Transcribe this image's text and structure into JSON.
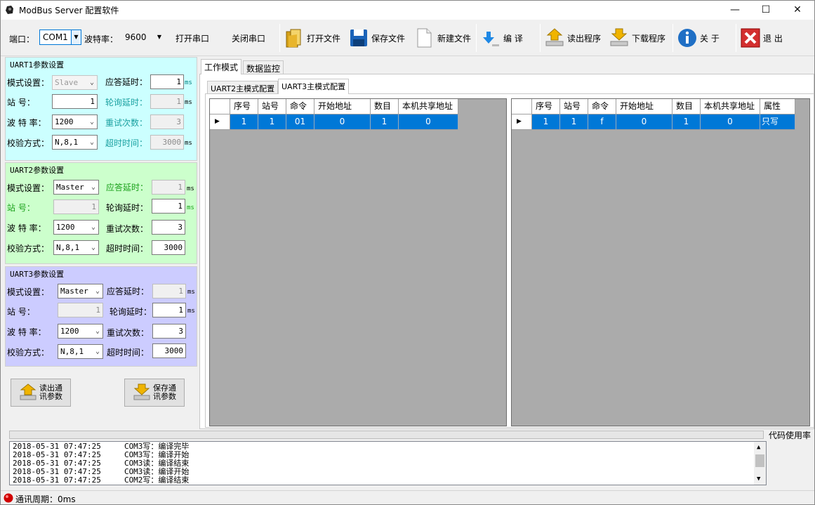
{
  "window": {
    "title": "ModBus Server 配置软件",
    "controls": {
      "minimize": "—",
      "maximize": "☐",
      "close": "✕"
    }
  },
  "toolbar": {
    "port_label": "端口：",
    "port_value": "COM1",
    "baud_label": "波特率：",
    "baud_value": "9600",
    "open_port": "打开串口",
    "close_port": "关闭串口",
    "open_file": "打开文件",
    "save_file": "保存文件",
    "new_file": "新建文件",
    "compile": "编  译",
    "read_program": "读出程序",
    "download_program": "下载程序",
    "about": "关  于",
    "exit": "退  出"
  },
  "uart1": {
    "title": "UART1参数设置",
    "mode_label": "模式设置：",
    "mode_value": "Slave",
    "reply_delay_label": "应答延时：",
    "reply_delay_value": "1",
    "station_label": "站  号：",
    "station_value": "1",
    "poll_delay_label": "轮询延时：",
    "poll_delay_value": "1",
    "baud_label": "波 特 率：",
    "baud_value": "1200",
    "retry_label": "重试次数：",
    "retry_value": "3",
    "parity_label": "校验方式：",
    "parity_value": "N,8,1",
    "timeout_label": "超时时间：",
    "timeout_value": "3000",
    "unit": "ms"
  },
  "uart2": {
    "title": "UART2参数设置",
    "mode_label": "模式设置：",
    "mode_value": "Master",
    "reply_delay_label": "应答延时：",
    "reply_delay_value": "1",
    "station_label": "站  号：",
    "station_value": "1",
    "poll_delay_label": "轮询延时：",
    "poll_delay_value": "1",
    "baud_label": "波 特 率：",
    "baud_value": "1200",
    "retry_label": "重试次数：",
    "retry_value": "3",
    "parity_label": "校验方式：",
    "parity_value": "N,8,1",
    "timeout_label": "超时时间：",
    "timeout_value": "3000",
    "unit": "ms"
  },
  "uart3": {
    "title": "UART3参数设置",
    "mode_label": "模式设置：",
    "mode_value": "Master",
    "reply_delay_label": "应答延时：",
    "reply_delay_value": "1",
    "station_label": "站  号：",
    "station_value": "1",
    "poll_delay_label": "轮询延时：",
    "poll_delay_value": "1",
    "baud_label": "波 特 率：",
    "baud_value": "1200",
    "retry_label": "重试次数：",
    "retry_value": "3",
    "parity_label": "校验方式：",
    "parity_value": "N,8,1",
    "timeout_label": "超时时间：",
    "timeout_value": "3000",
    "unit": "ms"
  },
  "buttons": {
    "read_comm_l1": "读出通",
    "read_comm_l2": "讯参数",
    "save_comm_l1": "保存通",
    "save_comm_l2": "讯参数"
  },
  "tabs": {
    "work_mode": "工作模式",
    "data_monitor": "数据监控",
    "uart2_master": "UART2主模式配置",
    "uart3_master": "UART3主模式配置"
  },
  "grid_left": {
    "headers": [
      "序号",
      "站号",
      "命令",
      "开始地址",
      "数目",
      "本机共享地址"
    ],
    "rows": [
      [
        "1",
        "1",
        "01",
        "0",
        "1",
        "0"
      ]
    ]
  },
  "grid_right": {
    "headers": [
      "序号",
      "站号",
      "命令",
      "开始地址",
      "数目",
      "本机共享地址",
      "属性"
    ],
    "rows": [
      [
        "1",
        "1",
        "f",
        "0",
        "1",
        "0",
        "只写"
      ]
    ]
  },
  "code_usage_label": "代码使用率",
  "log": [
    "2018-05-31 07:47:25     COM3写：编译完毕",
    "2018-05-31 07:47:25     COM3写：编译开始",
    "2018-05-31 07:47:25     COM3读：编译结束",
    "2018-05-31 07:47:25     COM3读：编译开始",
    "2018-05-31 07:47:25     COM2写：编译结束"
  ],
  "status": {
    "comm_cycle": "通讯周期：0ms"
  },
  "colors": {
    "uart1_bg": "#ccffff",
    "uart2_bg": "#ccffcc",
    "uart3_bg": "#ccccff",
    "selected_row": "#0078d7",
    "grid_bg": "#ababab"
  }
}
